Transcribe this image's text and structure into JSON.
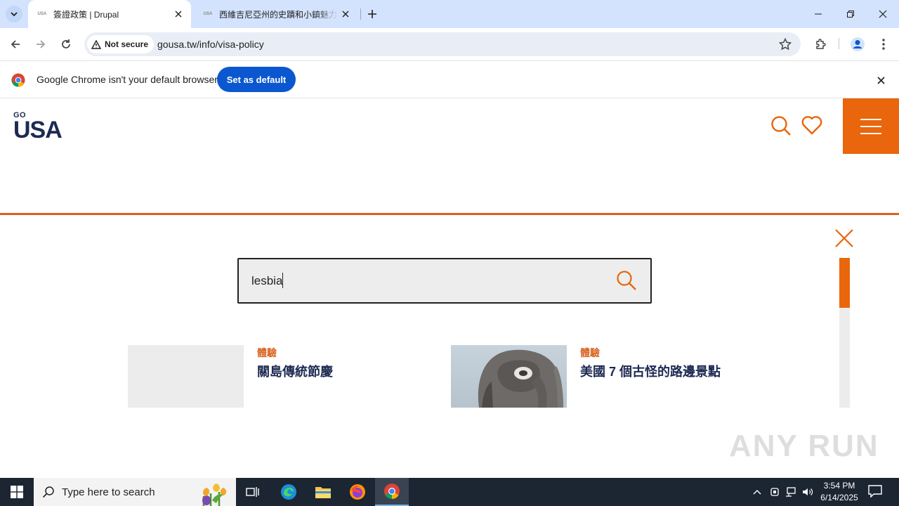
{
  "browser": {
    "tabs": [
      {
        "title": "簽證政策 | Drupal",
        "favicon": "USA",
        "active": true
      },
      {
        "title": "西維吉尼亞州的史蹟和小鎮魅力",
        "favicon": "USA",
        "active": false
      }
    ],
    "security_label": "Not secure",
    "url": "gousa.tw/info/visa-policy",
    "infobar": {
      "message": "Google Chrome isn't your default browser",
      "button": "Set as default"
    }
  },
  "site": {
    "logo_top": "GO",
    "logo_main": "USA",
    "accent_color": "#e9660c",
    "brand_color": "#1d2a52"
  },
  "search": {
    "query": "lesbia",
    "results": [
      {
        "category": "體驗",
        "title": "關島傳統節慶",
        "thumb": "placeholder"
      },
      {
        "category": "體驗",
        "title": "美國 7 個古怪的路邊景點",
        "thumb": "elephant-building"
      }
    ]
  },
  "watermark": "ANY RUN",
  "taskbar": {
    "search_placeholder": "Type here to search",
    "time": "3:54 PM",
    "date": "6/14/2025"
  }
}
